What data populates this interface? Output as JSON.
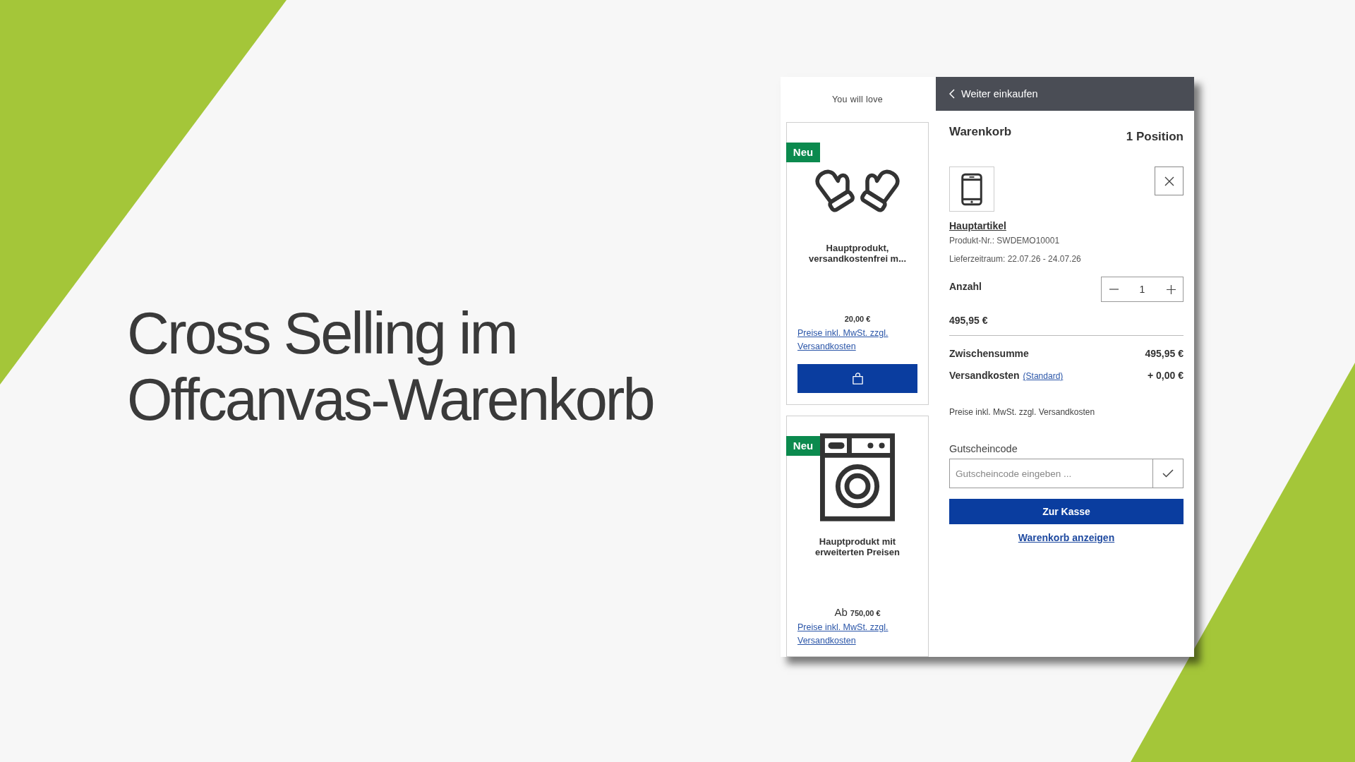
{
  "slide": {
    "title": "Cross Selling im Offcanvas-Warenkorb"
  },
  "cross_selling": {
    "heading": "You will love",
    "products": [
      {
        "badge": "Neu",
        "name": "Hauptprodukt, versandkostenfrei m...",
        "price": "20,00 €",
        "tax_note": "Preise inkl. MwSt. zzgl. Versandkosten",
        "cart_button": true
      },
      {
        "badge": "Neu",
        "name": "Hauptprodukt mit erweiterten Preisen",
        "price_prefix": "Ab",
        "price": "750,00 €",
        "tax_note": "Preise inkl. MwSt. zzgl. Versandkosten",
        "cart_button": false
      }
    ]
  },
  "cart": {
    "back_link": "Weiter einkaufen",
    "title": "Warenkorb",
    "count": "1 Position",
    "items": [
      {
        "name": "Hauptartikel",
        "product_number": "Produkt-Nr.: SWDEMO10001",
        "delivery": "Lieferzeitraum: 22.07.26 - 24.07.26",
        "quantity_label": "Anzahl",
        "quantity": "1",
        "price": "495,95 €"
      }
    ],
    "summary": [
      {
        "label": "Zwischensumme",
        "value": "495,95 €"
      },
      {
        "label": "Versandkosten",
        "link": "(Standard)",
        "value": "+ 0,00 €"
      }
    ],
    "tax_note": "Preise inkl. MwSt. zzgl. Versandkosten",
    "voucher": {
      "label": "Gutscheincode",
      "placeholder": "Gutscheincode eingeben ..."
    },
    "checkout_button": "Zur Kasse",
    "view_cart_link": "Warenkorb anzeigen"
  }
}
